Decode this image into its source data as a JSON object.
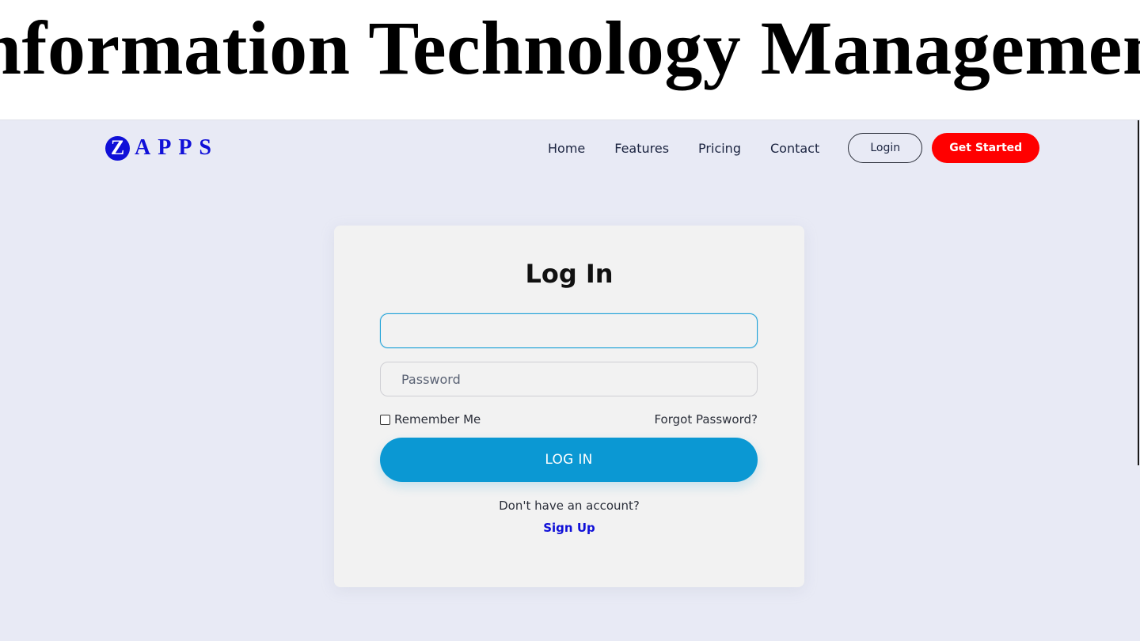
{
  "banner": {
    "title": "Information Technology Management"
  },
  "brand": {
    "logo_letter": "Z",
    "logo_text": "APPS",
    "logo_color": "#1010d8"
  },
  "nav": {
    "links": [
      "Home",
      "Features",
      "Pricing",
      "Contact"
    ],
    "login_label": "Login",
    "get_started_label": "Get Started",
    "get_started_color": "#ff0000"
  },
  "login_card": {
    "title": "Log In",
    "email_value": "",
    "password_placeholder": "Password",
    "remember_label": "Remember Me",
    "remember_checked": false,
    "forgot_label": "Forgot Password?",
    "submit_label": "LOG IN",
    "submit_color": "#0b98d3",
    "no_account_text": "Don't have an account?",
    "signup_label": "Sign Up"
  },
  "colors": {
    "page_background": "#e8eaf5",
    "card_background": "#f2f2f2"
  }
}
